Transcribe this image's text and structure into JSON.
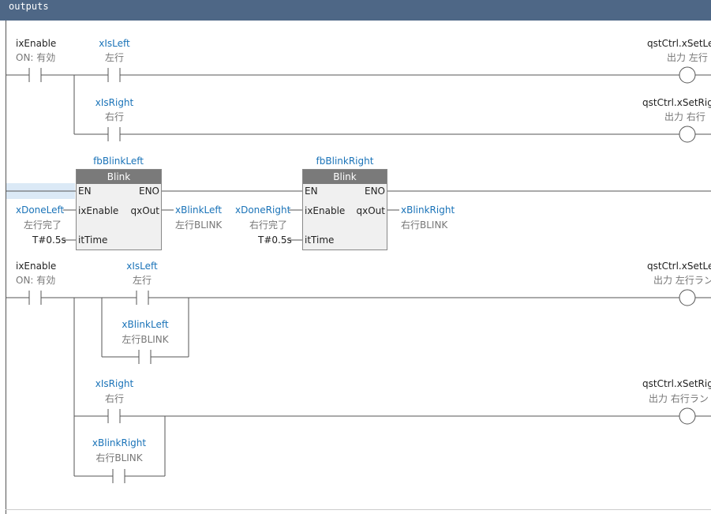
{
  "header": {
    "title": "outputs"
  },
  "rung1": {
    "enable": {
      "name": "ixEnable",
      "comment": "ON: 有効"
    },
    "left": {
      "name": "xIsLeft",
      "comment": "左行"
    },
    "right": {
      "name": "xIsRight",
      "comment": "右行"
    },
    "coil_left": {
      "name": "qstCtrl.xSetLe",
      "comment": "出力 左行"
    },
    "coil_right": {
      "name": "qstCtrl.xSetRigh",
      "comment": "出力 右行"
    }
  },
  "rung2": {
    "fb_left": {
      "instance": "fbBlinkLeft",
      "type": "Blink",
      "pin_en": "EN",
      "pin_eno": "ENO",
      "pin_enable": "ixEnable",
      "pin_out": "qxOut",
      "pin_time": "itTime",
      "in_var": "xDoneLeft",
      "in_comment": "左行完了",
      "time_val": "T#0.5s",
      "out_var": "xBlinkLeft",
      "out_comment": "左行BLINK"
    },
    "fb_right": {
      "instance": "fbBlinkRight",
      "type": "Blink",
      "pin_en": "EN",
      "pin_eno": "ENO",
      "pin_enable": "ixEnable",
      "pin_out": "qxOut",
      "pin_time": "itTime",
      "in_var": "xDoneRight",
      "in_comment": "右行完了",
      "time_val": "T#0.5s",
      "out_var": "xBlinkRight",
      "out_comment": "右行BLINK"
    }
  },
  "rung3": {
    "enable": {
      "name": "ixEnable",
      "comment": "ON: 有効"
    },
    "left": {
      "name": "xIsLeft",
      "comment": "左行"
    },
    "blink_left": {
      "name": "xBlinkLeft",
      "comment": "左行BLINK"
    },
    "right": {
      "name": "xIsRight",
      "comment": "右行"
    },
    "blink_right": {
      "name": "xBlinkRight",
      "comment": "右行BLINK"
    },
    "coil_left": {
      "name": "qstCtrl.xSetLe",
      "comment": "出力 左行ラン"
    },
    "coil_right": {
      "name": "qstCtrl.xSetRigh",
      "comment": "出力 右行ラン"
    }
  }
}
